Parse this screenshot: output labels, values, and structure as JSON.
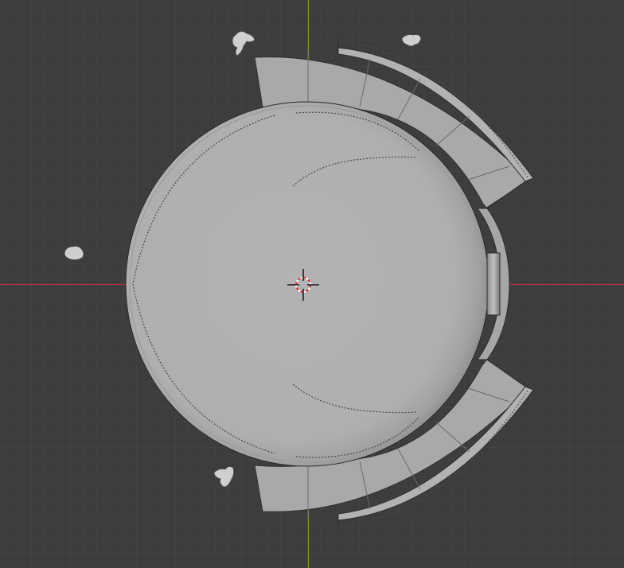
{
  "viewport": {
    "view": "top-orthographic",
    "background_color": "#3d3d3d",
    "grid_minor_color": "#444444",
    "grid_major_color": "#474747",
    "axis_x_color": "#c0363f",
    "axis_y_color": "#7a9a2a",
    "mesh_color": "#b0b0b0",
    "mesh_edge_color": "#2a2a2a",
    "cursor_icon": "3d-cursor-icon",
    "figure_icon": "person-figure-icon",
    "objects": [
      {
        "name": "dome",
        "shape": "circle"
      },
      {
        "name": "entrance-gap",
        "shape": "rectangle"
      },
      {
        "name": "upper-wing",
        "shape": "curved-wall"
      },
      {
        "name": "lower-wing",
        "shape": "curved-wall"
      },
      {
        "name": "figure-top-left",
        "shape": "figure"
      },
      {
        "name": "figure-top-right",
        "shape": "figure"
      },
      {
        "name": "figure-left",
        "shape": "figure"
      },
      {
        "name": "figure-bottom-left",
        "shape": "figure"
      }
    ]
  }
}
